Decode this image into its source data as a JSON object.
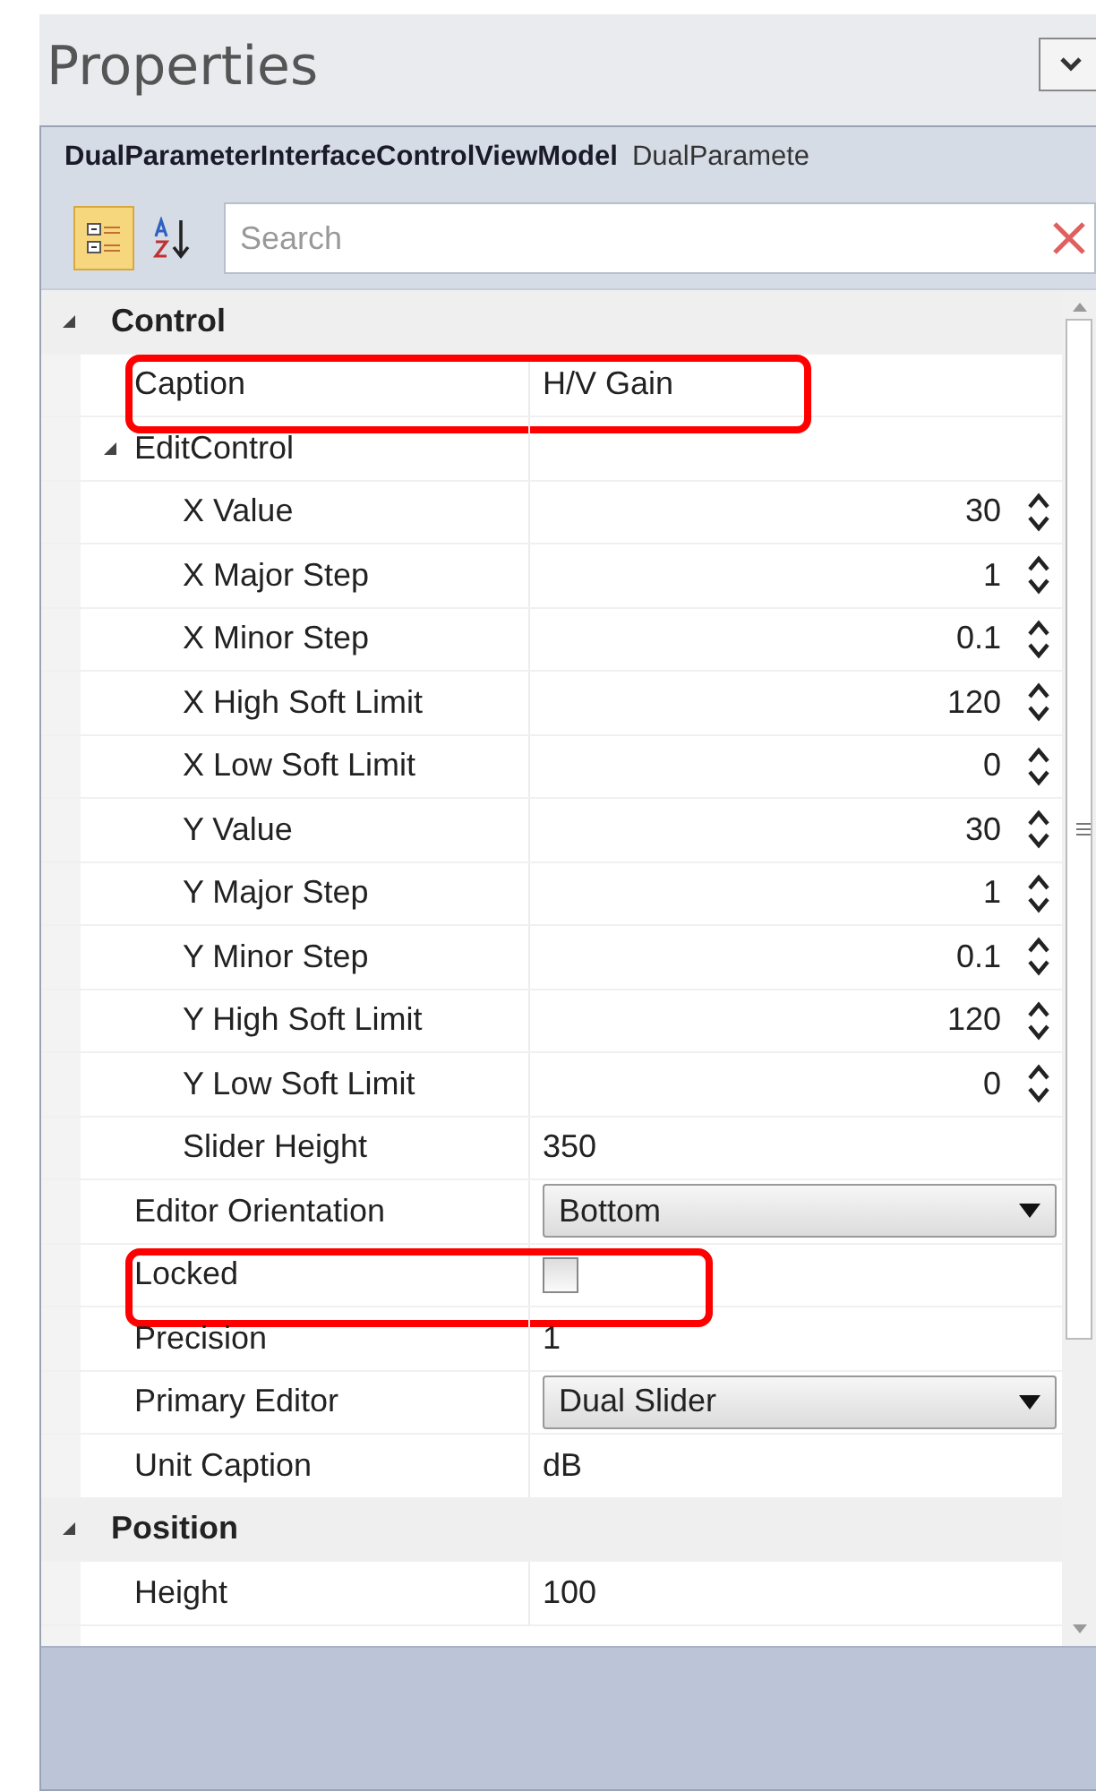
{
  "panel": {
    "title": "Properties"
  },
  "object": {
    "type_name": "DualParameterInterfaceControlViewModel",
    "name": "DualParamete"
  },
  "toolbar": [
    {
      "kind": "categorized",
      "selected": true
    },
    {
      "kind": "alphabetical",
      "selected": false
    }
  ],
  "search": {
    "placeholder": "Search"
  },
  "categories": [
    {
      "label": "Control",
      "expanded": true,
      "properties": [
        {
          "kind": "text",
          "name": "Caption",
          "value": "H/V Gain",
          "highlighted": true
        },
        {
          "kind": "group",
          "name": "EditControl",
          "expanded": true,
          "children": [
            {
              "kind": "spinner",
              "name": "X Value",
              "value": "30"
            },
            {
              "kind": "spinner",
              "name": "X Major Step",
              "value": "1"
            },
            {
              "kind": "spinner",
              "name": "X Minor Step",
              "value": "0.1"
            },
            {
              "kind": "spinner",
              "name": "X High Soft Limit",
              "value": "120"
            },
            {
              "kind": "spinner",
              "name": "X Low Soft Limit",
              "value": "0"
            },
            {
              "kind": "spinner",
              "name": "Y Value",
              "value": "30"
            },
            {
              "kind": "spinner",
              "name": "Y Major Step",
              "value": "1"
            },
            {
              "kind": "spinner",
              "name": "Y Minor Step",
              "value": "0.1"
            },
            {
              "kind": "spinner",
              "name": "Y High Soft Limit",
              "value": "120"
            },
            {
              "kind": "spinner",
              "name": "Y Low Soft Limit",
              "value": "0"
            },
            {
              "kind": "text",
              "name": "Slider Height",
              "value": "350"
            }
          ]
        },
        {
          "kind": "dropdown",
          "name": "Editor Orientation",
          "value": "Bottom"
        },
        {
          "kind": "checkbox",
          "name": "Locked",
          "checked": false,
          "highlighted": true
        },
        {
          "kind": "text",
          "name": "Precision",
          "value": "1"
        },
        {
          "kind": "dropdown",
          "name": "Primary Editor",
          "value": "Dual Slider"
        },
        {
          "kind": "text",
          "name": "Unit Caption",
          "value": "dB"
        }
      ]
    },
    {
      "label": "Position",
      "expanded": true,
      "properties": [
        {
          "kind": "text",
          "name": "Height",
          "value": "100"
        }
      ]
    }
  ]
}
